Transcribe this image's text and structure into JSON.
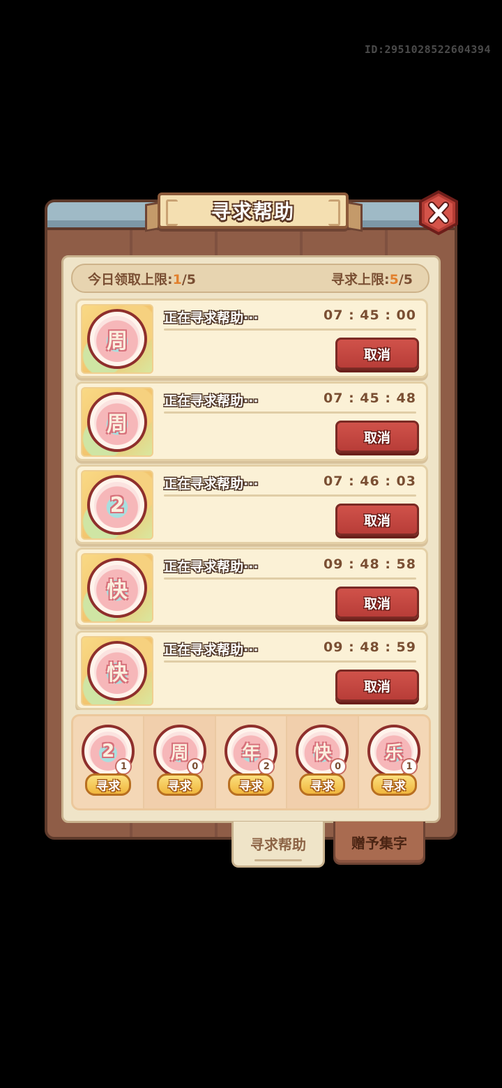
{
  "user_id": "ID:2951028522604394",
  "title": "寻求帮助",
  "limits": {
    "daily_label": "今日领取上限:",
    "daily_current": "1",
    "daily_total": "/5",
    "seek_label": "寻求上限:",
    "seek_current": "5",
    "seek_total": "/5"
  },
  "help_requests": [
    {
      "char": "周",
      "label": "正在寻求帮助···",
      "timer": "07 : 45 : 00",
      "cancel_label": "取消"
    },
    {
      "char": "周",
      "label": "正在寻求帮助···",
      "timer": "07 : 45 : 48",
      "cancel_label": "取消"
    },
    {
      "char": "2",
      "label": "正在寻求帮助···",
      "timer": "07 : 46 : 03",
      "cancel_label": "取消"
    },
    {
      "char": "快",
      "label": "正在寻求帮助···",
      "timer": "09 : 48 : 58",
      "cancel_label": "取消"
    },
    {
      "char": "快",
      "label": "正在寻求帮助···",
      "timer": "09 : 48 : 59",
      "cancel_label": "取消"
    }
  ],
  "collection": [
    {
      "char": "2",
      "count": "1",
      "button_label": "寻求"
    },
    {
      "char": "周",
      "count": "0",
      "button_label": "寻求"
    },
    {
      "char": "年",
      "count": "2",
      "button_label": "寻求"
    },
    {
      "char": "快",
      "count": "0",
      "button_label": "寻求"
    },
    {
      "char": "乐",
      "count": "1",
      "button_label": "寻求"
    }
  ],
  "tabs": {
    "seek_help": "寻求帮助",
    "gift_chars": "赠予集字"
  },
  "colors": {
    "accent_orange": "#e2802d",
    "cancel_red": "#c2443e",
    "seek_yellow": "#f3c24e",
    "wood": "#8a5a44",
    "parchment": "#efe4c8"
  },
  "icons": {
    "close": "close-x-icon"
  }
}
